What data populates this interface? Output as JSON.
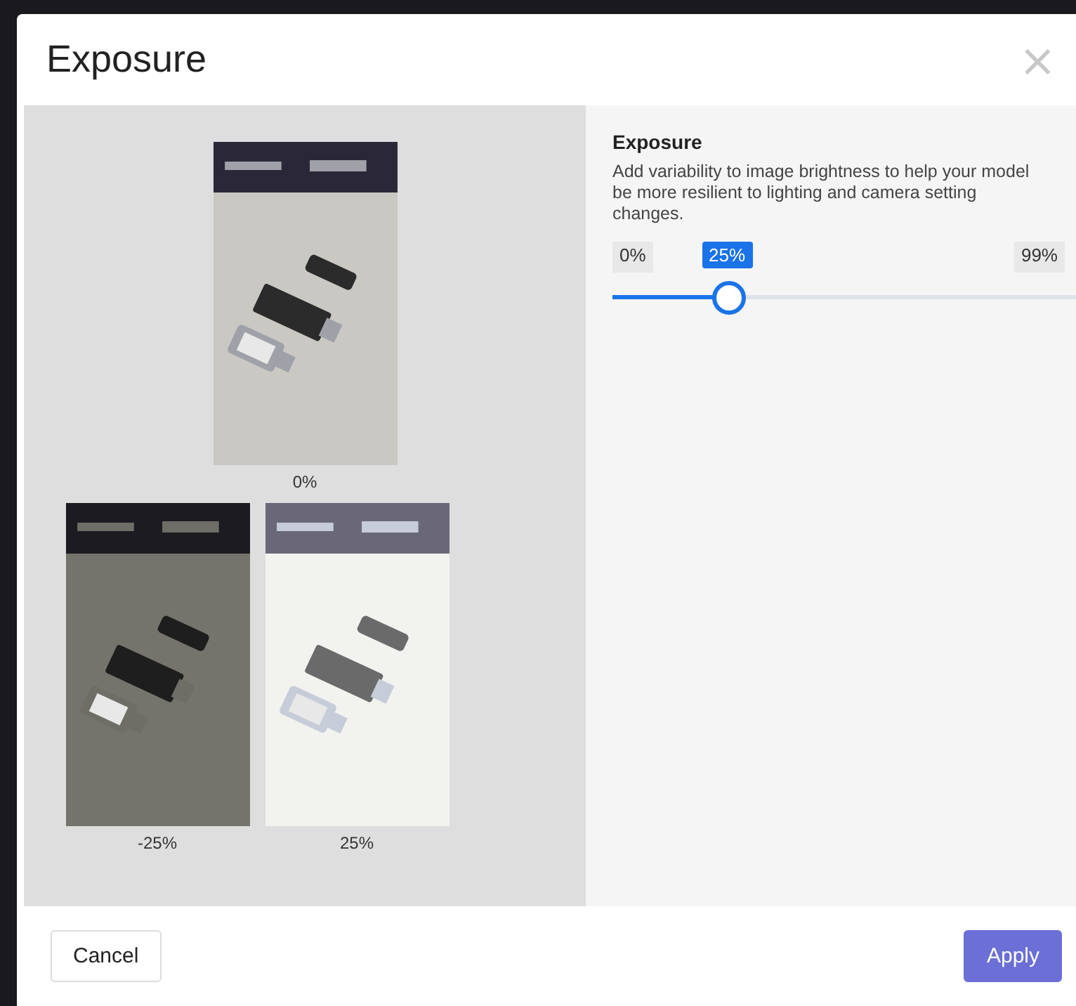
{
  "dialog": {
    "title": "Exposure",
    "close": "×"
  },
  "previews": [
    {
      "caption": "0%",
      "kind": "picture"
    },
    {
      "caption": "-25%",
      "kind": "picture"
    },
    {
      "caption": "25%",
      "kind": "picture"
    }
  ],
  "settings": {
    "heading": "Exposure",
    "description": "Add variability to image brightness to help your model be more resilient to lighting and camera setting changes.",
    "min_label": "0%",
    "value_label": "25%",
    "max_label": "99%",
    "level": 0.25
  },
  "buttons": [
    {
      "label": "Cancel",
      "kind": "secondary"
    },
    {
      "label": "Apply",
      "kind": "primary"
    }
  ]
}
